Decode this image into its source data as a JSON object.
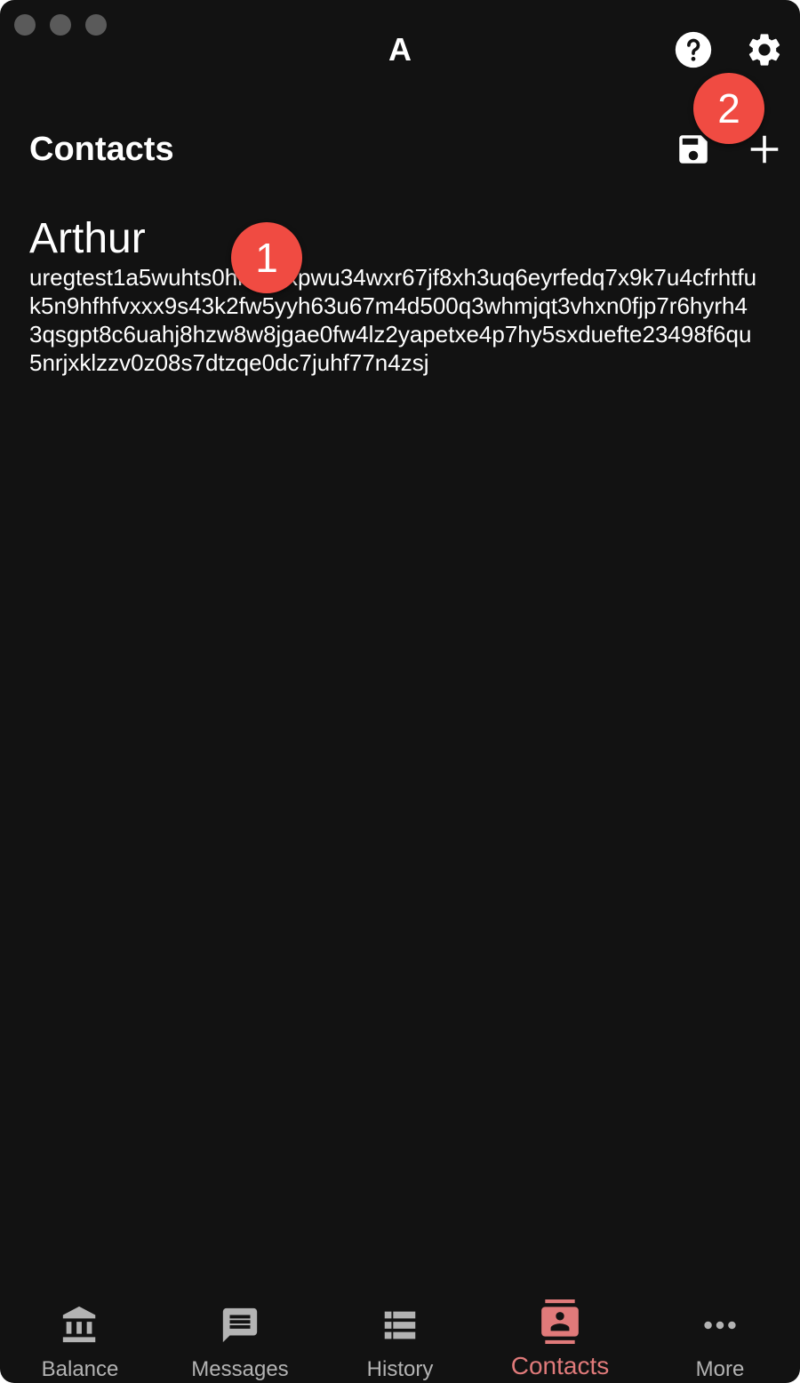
{
  "window": {
    "title": "A"
  },
  "toolbar": {
    "help_icon": "help-circle-icon",
    "settings_icon": "gear-icon"
  },
  "header": {
    "title": "Contacts",
    "save_icon": "floppy-disk-icon",
    "add_icon": "plus-icon"
  },
  "contacts": [
    {
      "name": "Arthur",
      "address": "uregtest1a5wuhts0hmw4xpwu34wxr67jf8xh3uq6eyrfedq7x9k7u4cfrhtfuk5n9hfhfvxxx9s43k2fw5yyh63u67m4d500q3whmjqt3vhxn0fjp7r6hyrh43qsgpt8c6uahj8hzw8w8jgae0fw4lz2yapetxe4p7hy5sxduefte23498f6qu5nrjxklzzv0z08s7dtzqe0dc7juhf77n4zsj"
    }
  ],
  "annotations": {
    "badge1": "1",
    "badge2": "2"
  },
  "nav": {
    "items": [
      {
        "label": "Balance",
        "icon": "bank-icon"
      },
      {
        "label": "Messages",
        "icon": "message-icon"
      },
      {
        "label": "History",
        "icon": "history-list-icon"
      },
      {
        "label": "Contacts",
        "icon": "contacts-icon",
        "active": true
      },
      {
        "label": "More",
        "icon": "more-dots-icon"
      }
    ]
  },
  "colors": {
    "background": "#121212",
    "accent": "#e07a7a",
    "badge": "#f04b42",
    "inactive": "#b3b3b3"
  }
}
